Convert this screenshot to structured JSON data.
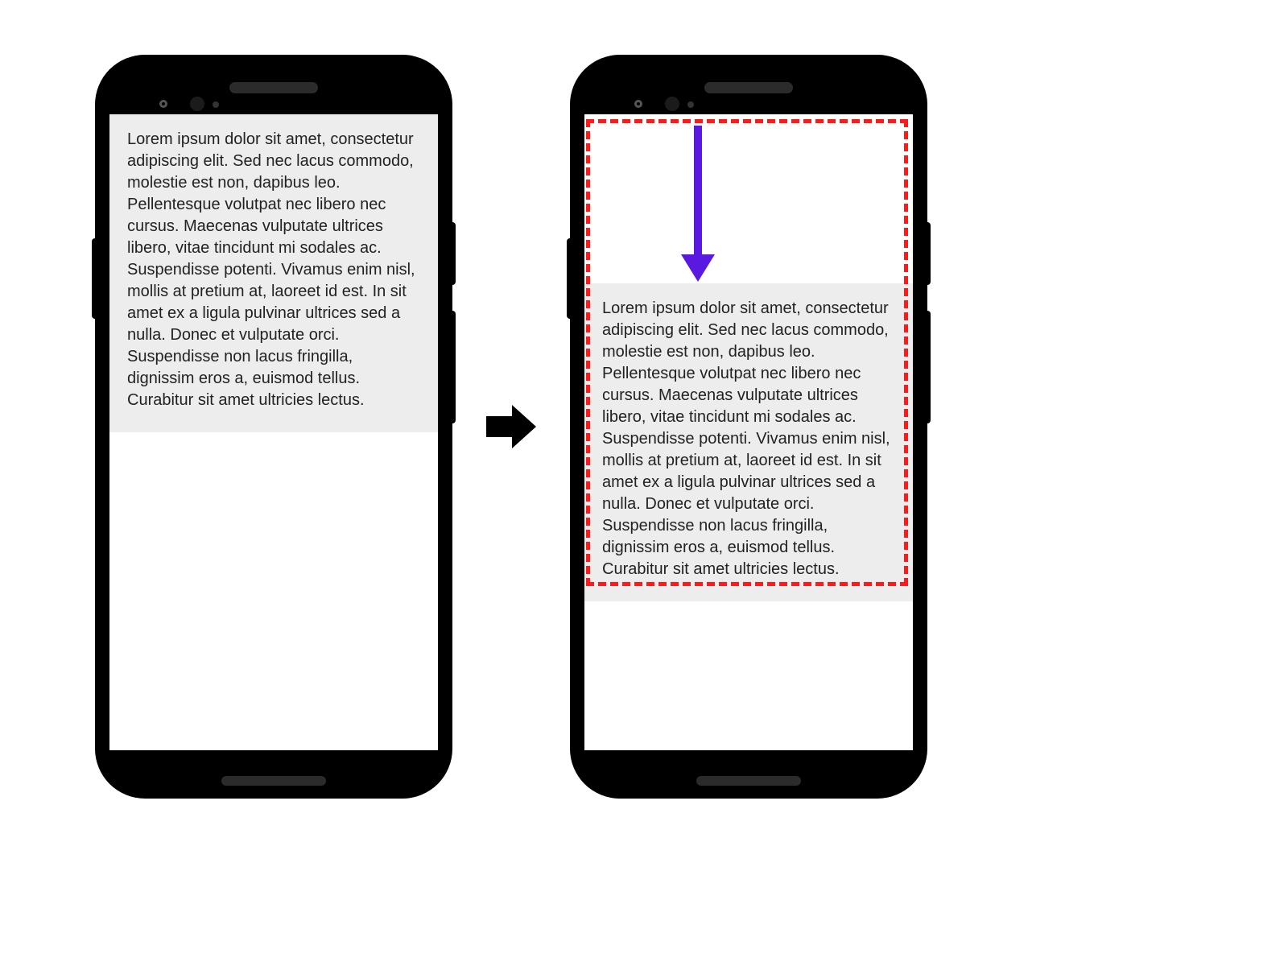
{
  "lorem": "Lorem ipsum dolor sit amet, consectetur adipiscing elit. Sed nec lacus commodo, molestie est non, dapibus leo. Pellentesque volutpat nec libero nec cursus. Maecenas vulputate ultrices libero, vitae tincidunt mi sodales ac. Suspendisse potenti. Vivamus enim nisl, mollis at pretium at, laoreet id est. In sit amet ex a ligula pulvinar ultrices sed a nulla. Donec et vulputate orci. Suspendisse non lacus fringilla, dignissim eros a, euismod tellus. Curabitur sit amet ultricies lectus.",
  "colors": {
    "highlight_dash": "#ff1a1a",
    "arrow": "#5a19e0",
    "card_bg": "#ededed"
  }
}
